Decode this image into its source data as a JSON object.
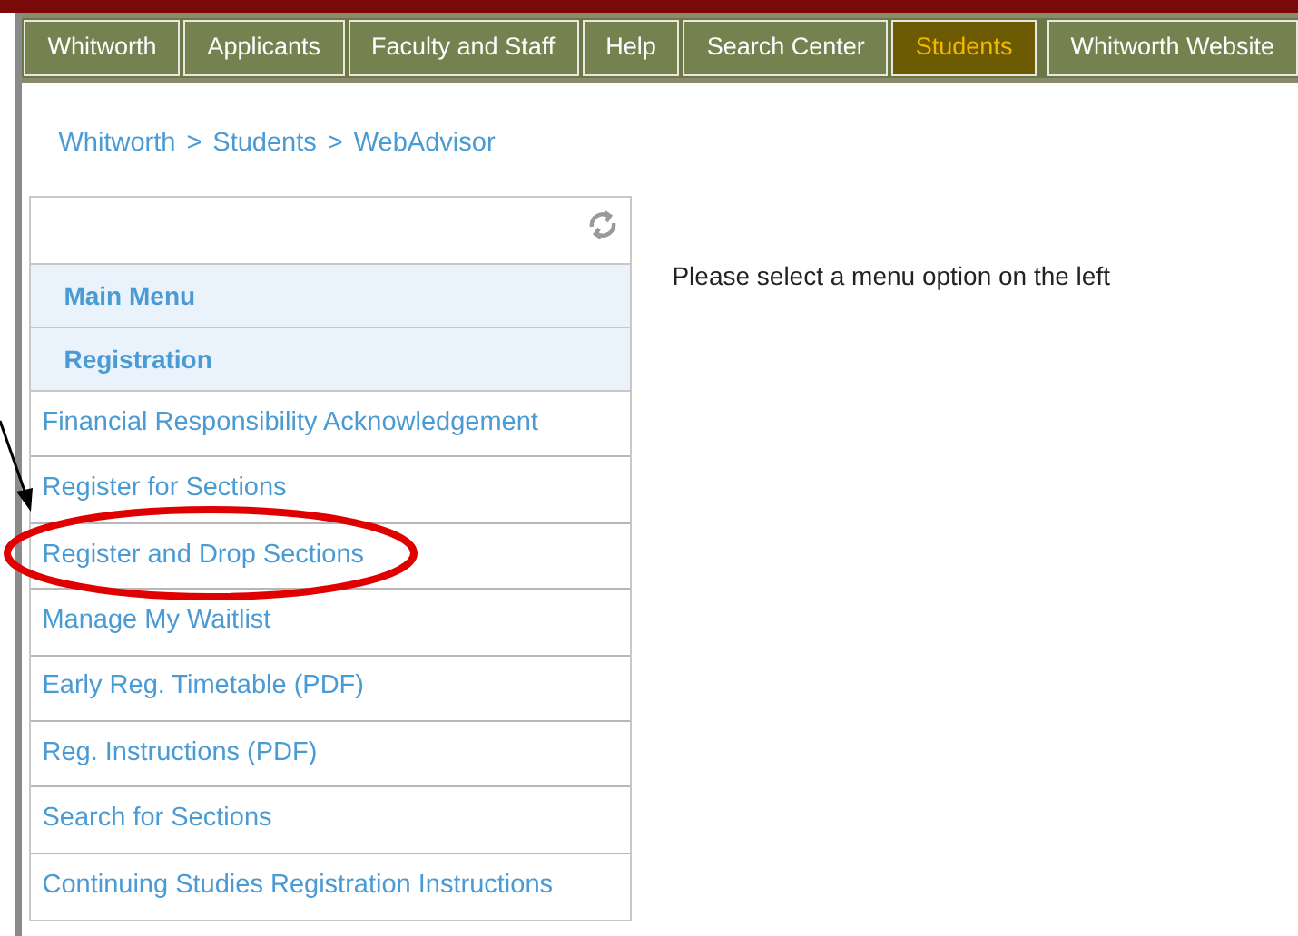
{
  "nav_tabs": [
    {
      "label": "Whitworth",
      "selected": false
    },
    {
      "label": "Applicants",
      "selected": false
    },
    {
      "label": "Faculty and Staff",
      "selected": false
    },
    {
      "label": "Help",
      "selected": false
    },
    {
      "label": "Search Center",
      "selected": false
    },
    {
      "label": "Students",
      "selected": true
    },
    {
      "label": "Whitworth Website",
      "selected": false
    }
  ],
  "breadcrumb": [
    {
      "label": "Whitworth",
      "separator": ">"
    },
    {
      "label": "Students",
      "separator": ">"
    },
    {
      "label": "WebAdvisor"
    }
  ],
  "sidebar": {
    "headers": [
      "Main Menu",
      "Registration"
    ],
    "items": [
      {
        "label": "Financial Responsibility Acknowledgement"
      },
      {
        "label": "Register for Sections"
      },
      {
        "label": "Register and Drop Sections"
      },
      {
        "label": "Manage My Waitlist"
      },
      {
        "label": "Early Reg. Timetable (PDF)"
      },
      {
        "label": "Reg. Instructions (PDF)"
      },
      {
        "label": "Search for Sections"
      },
      {
        "label": "Continuing Studies Registration Instructions"
      }
    ]
  },
  "main_message": "Please select a menu option on the left"
}
